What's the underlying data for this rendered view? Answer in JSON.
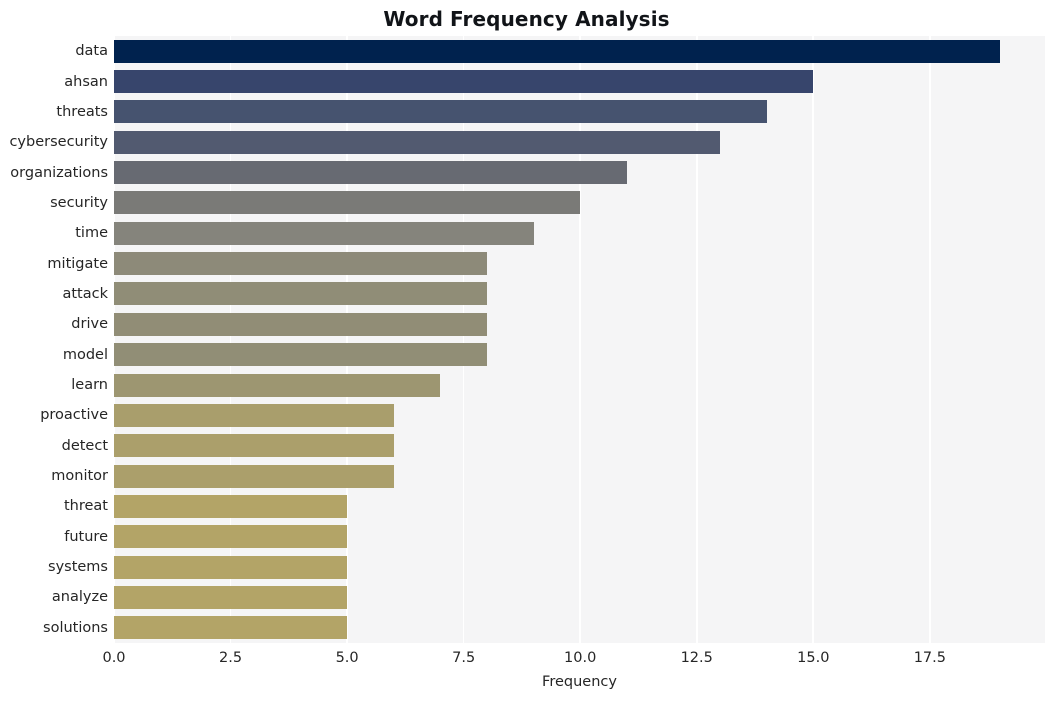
{
  "chart_data": {
    "type": "bar",
    "orientation": "horizontal",
    "title": "Word Frequency Analysis",
    "xlabel": "Frequency",
    "ylabel": "",
    "xlim": [
      0,
      19.97
    ],
    "xticks": [
      0.0,
      2.5,
      5.0,
      7.5,
      10.0,
      12.5,
      15.0,
      17.5
    ],
    "xticklabels": [
      "0.0",
      "2.5",
      "5.0",
      "7.5",
      "10.0",
      "12.5",
      "15.0",
      "17.5"
    ],
    "grid": true,
    "legend": null,
    "categories": [
      "data",
      "ahsan",
      "threats",
      "cybersecurity",
      "organizations",
      "security",
      "time",
      "mitigate",
      "attack",
      "drive",
      "model",
      "learn",
      "proactive",
      "detect",
      "monitor",
      "threat",
      "future",
      "systems",
      "analyze",
      "solutions"
    ],
    "values": [
      19,
      15,
      14,
      13,
      11,
      10,
      9,
      8,
      8,
      8,
      8,
      7,
      6,
      6,
      6,
      5,
      5,
      5,
      5,
      5
    ],
    "bar_colors": [
      "#00224e",
      "#37456c",
      "#46536f",
      "#525a70",
      "#676a72",
      "#7a7a77",
      "#85847c",
      "#8d8a79",
      "#908d77",
      "#918d76",
      "#918e76",
      "#9d9671",
      "#a99e6c",
      "#ab9f6b",
      "#ab9f6b",
      "#b3a467",
      "#b3a467",
      "#b3a467",
      "#b3a467",
      "#b3a467"
    ],
    "plot_background": "#f5f5f6",
    "grid_color": "#ffffff",
    "figure_background": "#ffffff",
    "tick_color": "#262626",
    "title_color": "#111418"
  }
}
